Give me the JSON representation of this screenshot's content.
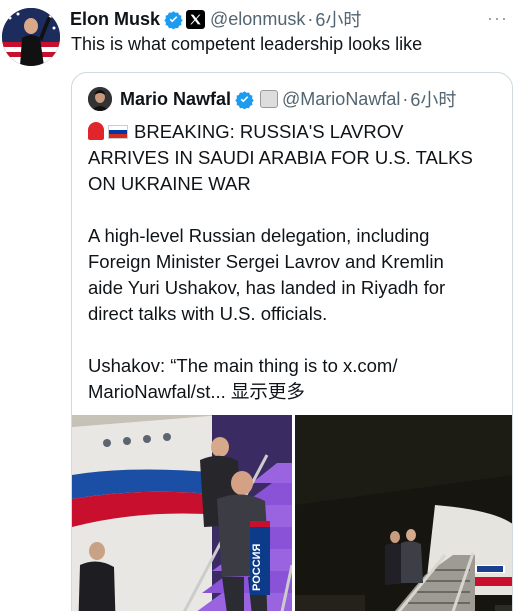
{
  "tweet": {
    "author_name": "Elon Musk",
    "handle": "@elonmusk",
    "separator": "·",
    "time": "6小时",
    "more_label": "···",
    "text": "This is what competent leadership looks like"
  },
  "quote": {
    "author_name": "Mario Nawfal",
    "handle": "@MarioNawfal",
    "separator": "·",
    "time": "6小时",
    "lines": [
      "BREAKING: RUSSIA'S LAVROV",
      "ARRIVES IN SAUDI ARABIA FOR U.S. TALKS",
      "ON UKRAINE WAR",
      "",
      "A high-level Russian delegation, including",
      "Foreign Minister Sergei Lavrov and Kremlin",
      "aide Yuri Ushakov, has landed in Riyadh for",
      "direct talks with U.S. officials.",
      "",
      "Ushakov: “The main thing is to x.com/",
      "MarioNawfal/st..."
    ],
    "show_more": "显示更多",
    "photo_1_sign": "РОССИЯ"
  },
  "colors": {
    "text": "#0f1419",
    "secondary": "#536471",
    "verified": "#1d9bf0",
    "border": "#cfd9de"
  }
}
